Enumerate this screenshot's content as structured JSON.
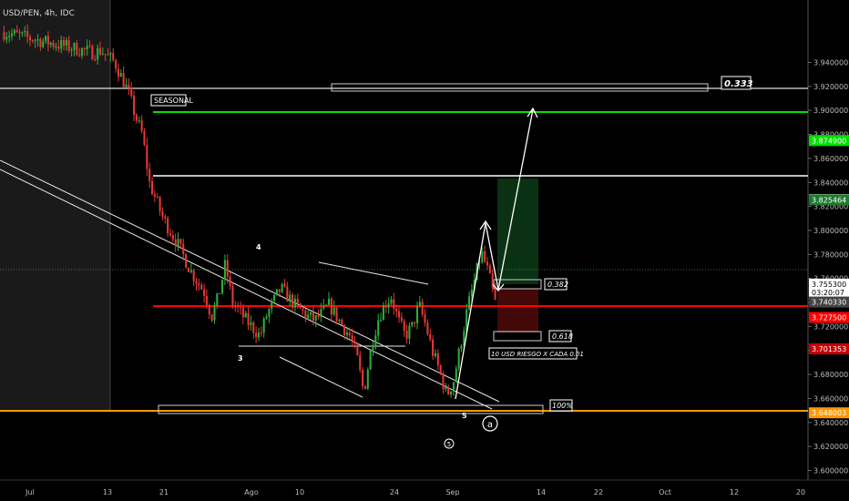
{
  "symbol_title": "USD/PEN, 4h, IDC",
  "chart_data": {
    "type": "candlestick",
    "ylim": [
      3.592,
      3.992
    ],
    "x_axis_labels": [
      "Jul",
      "13",
      "21",
      "Ago",
      "10",
      "24",
      "Sep",
      "14",
      "22",
      "Oct",
      "12",
      "20"
    ],
    "y_ticks": [
      "3.600000",
      "3.620000",
      "3.640000",
      "3.660000",
      "3.680000",
      "3.700000",
      "3.720000",
      "3.740000",
      "3.760000",
      "3.780000",
      "3.800000",
      "3.820000",
      "3.840000",
      "3.860000",
      "3.880000",
      "3.900000",
      "3.920000",
      "3.940000"
    ],
    "price_levels": [
      {
        "label": "3.874900",
        "value": 3.8749,
        "color": "#00e000"
      },
      {
        "label": "3.825700",
        "value": 3.8257,
        "color": "#ffffff"
      },
      {
        "label": "3.825464",
        "value": 3.825464,
        "color": "#1e7a2e"
      },
      {
        "label": "3.755300",
        "value": 3.7553,
        "color": "#ffffff"
      },
      {
        "label": "03:20:07",
        "value": 3.7482,
        "color": "#ffffff"
      },
      {
        "label": "3.740330",
        "value": 3.74033,
        "color": "#444444"
      },
      {
        "label": "3.727500",
        "value": 3.7275,
        "color": "#ff0000"
      },
      {
        "label": "3.701353",
        "value": 3.701353,
        "color": "#c80000"
      },
      {
        "label": "3.648003",
        "value": 3.648003,
        "color": "#ff9800"
      }
    ],
    "annotations": {
      "seasonal": "SEASONAL",
      "fib_0333": "0.333",
      "fib_0382": "0.382",
      "fib_0618": "0.618",
      "fib_100": "100%",
      "risk_note": "10 USD RIESGO X CADA 0.01",
      "wave_3": "3",
      "wave_4": "4",
      "wave_5": "5",
      "wave_5_circle": "5",
      "wave_a_circle": "a"
    },
    "series": [
      {
        "type": "candles",
        "note": "Close prices approximated from the drawn price path",
        "close_path": [
          [
            0,
            3.965
          ],
          [
            13,
            3.948
          ],
          [
            14,
            3.95
          ],
          [
            16,
            3.94
          ],
          [
            18,
            3.915
          ],
          [
            19,
            3.895
          ],
          [
            20,
            3.88
          ],
          [
            21,
            3.84
          ],
          [
            23,
            3.81
          ],
          [
            25,
            3.79
          ],
          [
            27,
            3.766
          ],
          [
            29,
            3.748
          ],
          [
            30,
            3.728
          ],
          [
            31,
            3.745
          ],
          [
            32,
            3.772
          ],
          [
            33,
            3.74
          ],
          [
            35,
            3.725
          ],
          [
            37,
            3.712
          ],
          [
            38,
            3.73
          ],
          [
            40,
            3.752
          ],
          [
            42,
            3.738
          ],
          [
            44,
            3.728
          ],
          [
            45,
            3.725
          ],
          [
            47,
            3.738
          ],
          [
            49,
            3.72
          ],
          [
            50,
            3.712
          ],
          [
            51,
            3.695
          ],
          [
            52,
            3.665
          ],
          [
            53,
            3.7
          ],
          [
            54,
            3.725
          ],
          [
            55,
            3.738
          ],
          [
            56,
            3.745
          ],
          [
            57,
            3.725
          ],
          [
            58,
            3.712
          ],
          [
            59,
            3.72
          ],
          [
            60,
            3.738
          ],
          [
            61,
            3.72
          ],
          [
            62,
            3.698
          ],
          [
            63,
            3.682
          ],
          [
            64,
            3.662
          ],
          [
            65,
            3.675
          ],
          [
            66,
            3.705
          ],
          [
            67,
            3.735
          ],
          [
            68,
            3.758
          ],
          [
            69,
            3.782
          ],
          [
            70,
            3.765
          ],
          [
            71,
            3.74
          ]
        ]
      }
    ]
  }
}
